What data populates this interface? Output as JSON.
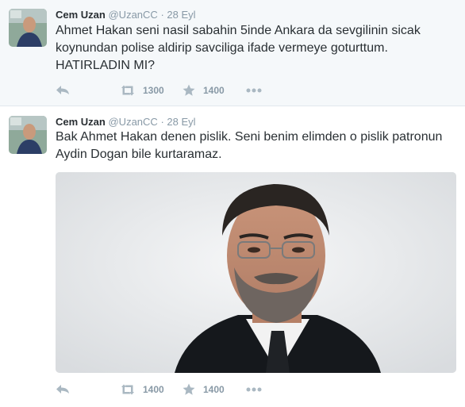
{
  "tweets": [
    {
      "name": "Cem Uzan",
      "handle": "@UzanCC",
      "separator": "·",
      "date": "28 Eyl",
      "text": "Ahmet Hakan seni nasil sabahin 5inde Ankara da sevgilinin sicak koynundan polise aldirip savciliga ifade vermeye goturttum. HATIRLADIN MI?",
      "retweets": "1300",
      "favorites": "1400",
      "icons": [
        "reply-icon",
        "retweet-icon",
        "favorite-star-icon",
        "more-icon"
      ]
    },
    {
      "name": "Cem Uzan",
      "handle": "@UzanCC",
      "separator": "·",
      "date": "28 Eyl",
      "text": "Bak Ahmet Hakan denen pislik. Seni benim elimden o pislik patronun Aydin Dogan bile kurtaramaz.",
      "retweets": "1400",
      "favorites": "1400",
      "icons": [
        "reply-icon",
        "retweet-icon",
        "favorite-star-icon",
        "more-icon"
      ],
      "media": "photo of a grey-bearded man in glasses, dark suit and tie"
    }
  ],
  "colors": {
    "name": "#292f33",
    "meta": "#8899a6",
    "background_first": "#f5f8fa",
    "divider": "#e1e8ed"
  }
}
